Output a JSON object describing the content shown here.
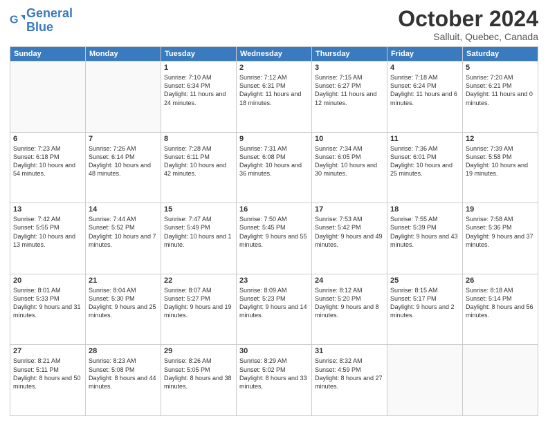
{
  "logo": {
    "line1": "General",
    "line2": "Blue"
  },
  "title": "October 2024",
  "subtitle": "Salluit, Quebec, Canada",
  "days_of_week": [
    "Sunday",
    "Monday",
    "Tuesday",
    "Wednesday",
    "Thursday",
    "Friday",
    "Saturday"
  ],
  "weeks": [
    [
      {
        "day": "",
        "info": ""
      },
      {
        "day": "",
        "info": ""
      },
      {
        "day": "1",
        "info": "Sunrise: 7:10 AM\nSunset: 6:34 PM\nDaylight: 11 hours and 24 minutes."
      },
      {
        "day": "2",
        "info": "Sunrise: 7:12 AM\nSunset: 6:31 PM\nDaylight: 11 hours and 18 minutes."
      },
      {
        "day": "3",
        "info": "Sunrise: 7:15 AM\nSunset: 6:27 PM\nDaylight: 11 hours and 12 minutes."
      },
      {
        "day": "4",
        "info": "Sunrise: 7:18 AM\nSunset: 6:24 PM\nDaylight: 11 hours and 6 minutes."
      },
      {
        "day": "5",
        "info": "Sunrise: 7:20 AM\nSunset: 6:21 PM\nDaylight: 11 hours and 0 minutes."
      }
    ],
    [
      {
        "day": "6",
        "info": "Sunrise: 7:23 AM\nSunset: 6:18 PM\nDaylight: 10 hours and 54 minutes."
      },
      {
        "day": "7",
        "info": "Sunrise: 7:26 AM\nSunset: 6:14 PM\nDaylight: 10 hours and 48 minutes."
      },
      {
        "day": "8",
        "info": "Sunrise: 7:28 AM\nSunset: 6:11 PM\nDaylight: 10 hours and 42 minutes."
      },
      {
        "day": "9",
        "info": "Sunrise: 7:31 AM\nSunset: 6:08 PM\nDaylight: 10 hours and 36 minutes."
      },
      {
        "day": "10",
        "info": "Sunrise: 7:34 AM\nSunset: 6:05 PM\nDaylight: 10 hours and 30 minutes."
      },
      {
        "day": "11",
        "info": "Sunrise: 7:36 AM\nSunset: 6:01 PM\nDaylight: 10 hours and 25 minutes."
      },
      {
        "day": "12",
        "info": "Sunrise: 7:39 AM\nSunset: 5:58 PM\nDaylight: 10 hours and 19 minutes."
      }
    ],
    [
      {
        "day": "13",
        "info": "Sunrise: 7:42 AM\nSunset: 5:55 PM\nDaylight: 10 hours and 13 minutes."
      },
      {
        "day": "14",
        "info": "Sunrise: 7:44 AM\nSunset: 5:52 PM\nDaylight: 10 hours and 7 minutes."
      },
      {
        "day": "15",
        "info": "Sunrise: 7:47 AM\nSunset: 5:49 PM\nDaylight: 10 hours and 1 minute."
      },
      {
        "day": "16",
        "info": "Sunrise: 7:50 AM\nSunset: 5:45 PM\nDaylight: 9 hours and 55 minutes."
      },
      {
        "day": "17",
        "info": "Sunrise: 7:53 AM\nSunset: 5:42 PM\nDaylight: 9 hours and 49 minutes."
      },
      {
        "day": "18",
        "info": "Sunrise: 7:55 AM\nSunset: 5:39 PM\nDaylight: 9 hours and 43 minutes."
      },
      {
        "day": "19",
        "info": "Sunrise: 7:58 AM\nSunset: 5:36 PM\nDaylight: 9 hours and 37 minutes."
      }
    ],
    [
      {
        "day": "20",
        "info": "Sunrise: 8:01 AM\nSunset: 5:33 PM\nDaylight: 9 hours and 31 minutes."
      },
      {
        "day": "21",
        "info": "Sunrise: 8:04 AM\nSunset: 5:30 PM\nDaylight: 9 hours and 25 minutes."
      },
      {
        "day": "22",
        "info": "Sunrise: 8:07 AM\nSunset: 5:27 PM\nDaylight: 9 hours and 19 minutes."
      },
      {
        "day": "23",
        "info": "Sunrise: 8:09 AM\nSunset: 5:23 PM\nDaylight: 9 hours and 14 minutes."
      },
      {
        "day": "24",
        "info": "Sunrise: 8:12 AM\nSunset: 5:20 PM\nDaylight: 9 hours and 8 minutes."
      },
      {
        "day": "25",
        "info": "Sunrise: 8:15 AM\nSunset: 5:17 PM\nDaylight: 9 hours and 2 minutes."
      },
      {
        "day": "26",
        "info": "Sunrise: 8:18 AM\nSunset: 5:14 PM\nDaylight: 8 hours and 56 minutes."
      }
    ],
    [
      {
        "day": "27",
        "info": "Sunrise: 8:21 AM\nSunset: 5:11 PM\nDaylight: 8 hours and 50 minutes."
      },
      {
        "day": "28",
        "info": "Sunrise: 8:23 AM\nSunset: 5:08 PM\nDaylight: 8 hours and 44 minutes."
      },
      {
        "day": "29",
        "info": "Sunrise: 8:26 AM\nSunset: 5:05 PM\nDaylight: 8 hours and 38 minutes."
      },
      {
        "day": "30",
        "info": "Sunrise: 8:29 AM\nSunset: 5:02 PM\nDaylight: 8 hours and 33 minutes."
      },
      {
        "day": "31",
        "info": "Sunrise: 8:32 AM\nSunset: 4:59 PM\nDaylight: 8 hours and 27 minutes."
      },
      {
        "day": "",
        "info": ""
      },
      {
        "day": "",
        "info": ""
      }
    ]
  ]
}
